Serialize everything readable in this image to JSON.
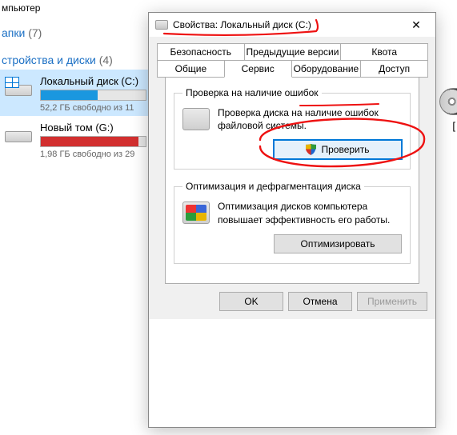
{
  "explorer": {
    "top_cut_label": "мпьютер",
    "section_folders": {
      "label_cut": "апки",
      "count": "(7)"
    },
    "section_drives": {
      "label_cut": "стройства и диски",
      "count": "(4)"
    },
    "drives": [
      {
        "name": "Локальный диск (C:)",
        "free": "52,2 ГБ свободно из 11",
        "fill_pct": 54,
        "color": "blue",
        "selected": true,
        "has_win_logo": true
      },
      {
        "name": "Новый том (G:)",
        "free": "1,98 ГБ свободно из 29",
        "fill_pct": 93,
        "color": "red",
        "selected": false,
        "has_win_logo": false
      }
    ],
    "right_letter": "["
  },
  "dialog": {
    "title": "Свойства: Локальный диск (C:)",
    "tabs_back": [
      "Безопасность",
      "Предыдущие версии",
      "Квота"
    ],
    "tabs_front": [
      "Общие",
      "Сервис",
      "Оборудование",
      "Доступ"
    ],
    "active_tab": "Сервис",
    "group_check": {
      "legend": "Проверка на наличие ошибок",
      "text": "Проверка диска на наличие ошибок файловой системы.",
      "button": "Проверить"
    },
    "group_defrag": {
      "legend": "Оптимизация и дефрагментация диска",
      "text": "Оптимизация дисков компьютера повышает эффективность его работы.",
      "button": "Оптимизировать"
    },
    "footer": {
      "ok": "OK",
      "cancel": "Отмена",
      "apply": "Применить"
    }
  }
}
